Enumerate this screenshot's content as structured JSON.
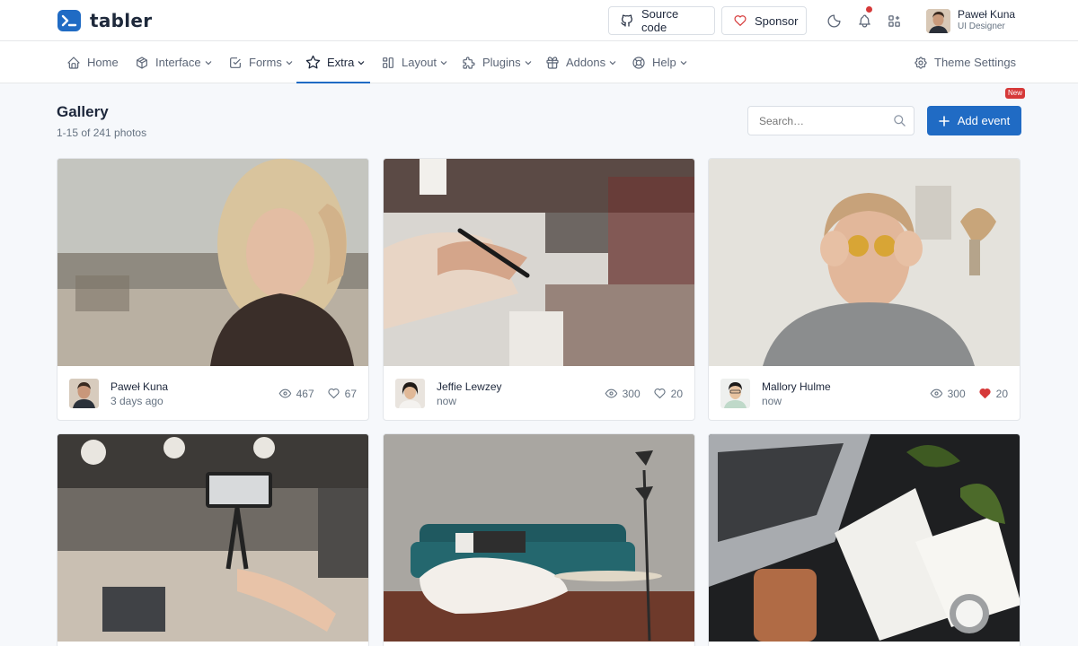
{
  "brand": {
    "name": "tabler"
  },
  "header": {
    "source_label": "Source code",
    "sponsor_label": "Sponsor",
    "user": {
      "name": "Paweł Kuna",
      "role": "UI Designer"
    }
  },
  "nav": {
    "home": "Home",
    "interface": "Interface",
    "forms": "Forms",
    "extra": "Extra",
    "layout": "Layout",
    "plugins": "Plugins",
    "addons": "Addons",
    "help": "Help",
    "theme": "Theme Settings",
    "new_badge": "New"
  },
  "page": {
    "title": "Gallery",
    "subtitle": "1-15 of 241 photos",
    "search_placeholder": "Search…",
    "add_label": "Add event"
  },
  "cards": [
    {
      "author": "Paweł Kuna",
      "time": "3 days ago",
      "views": "467",
      "likes": "67",
      "liked": false
    },
    {
      "author": "Jeffie Lewzey",
      "time": "now",
      "views": "300",
      "likes": "20",
      "liked": false
    },
    {
      "author": "Mallory Hulme",
      "time": "now",
      "views": "300",
      "likes": "20",
      "liked": true
    }
  ],
  "colors": {
    "primary": "#206bc4",
    "danger": "#d63939"
  },
  "icons": [
    "brand-logo-icon",
    "github-icon",
    "heart-icon",
    "moon-icon",
    "bell-icon",
    "apps-icon",
    "home-icon",
    "package-icon",
    "checkbox-icon",
    "star-icon",
    "layout-icon",
    "puzzle-icon",
    "gift-icon",
    "lifebuoy-icon",
    "settings-icon",
    "search-icon",
    "plus-icon",
    "eye-icon"
  ]
}
